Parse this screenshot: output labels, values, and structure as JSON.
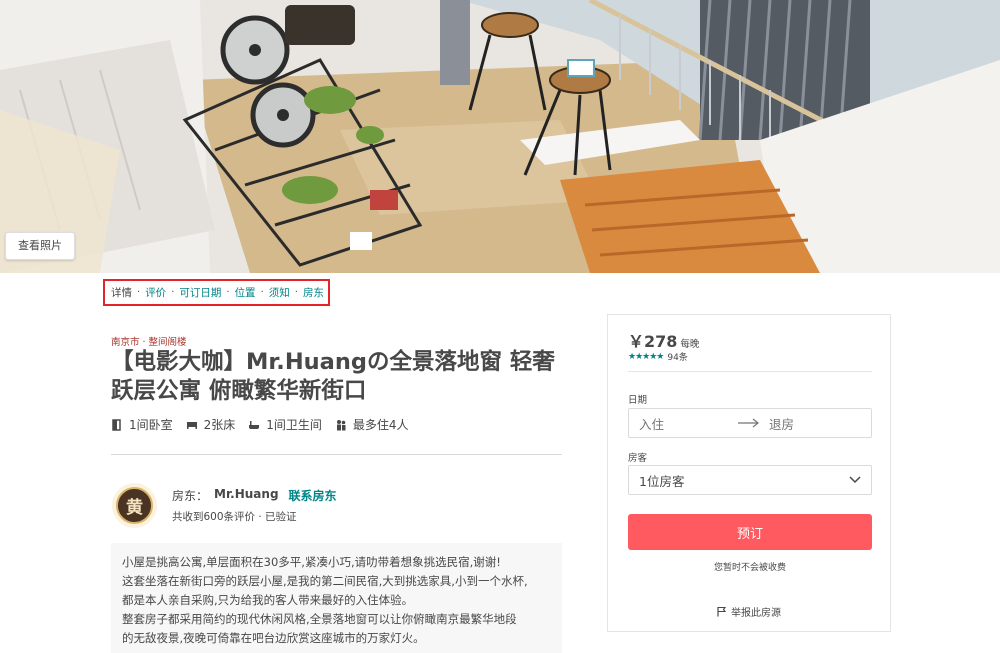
{
  "hero": {
    "view_photos_label": "查看照片"
  },
  "subnav": {
    "items": [
      {
        "label": "详情"
      },
      {
        "label": "评价"
      },
      {
        "label": "可订日期"
      },
      {
        "label": "位置"
      },
      {
        "label": "须知"
      },
      {
        "label": "房东"
      }
    ],
    "separator": "·"
  },
  "listing": {
    "breadcrumb": "南京市 · 整间阁楼",
    "title": "【电影大咖】Mr.Huangの全景落地窗 轻奢跃层公寓 俯瞰繁华新街口",
    "amenities": [
      {
        "icon": "door-icon",
        "label": "1间卧室"
      },
      {
        "icon": "bed-icon",
        "label": "2张床"
      },
      {
        "icon": "bathtub-icon",
        "label": "1间卫生间"
      },
      {
        "icon": "guests-icon",
        "label": "最多住4人"
      }
    ]
  },
  "host": {
    "avatar_char": "黄",
    "prefix": "房东：",
    "name": "Mr.Huang",
    "contact_label": "联系房东",
    "meta": "共收到600条评价 · 已验证"
  },
  "description": {
    "lines": [
      "小屋是挑高公寓,单层面积在30多平,紧凑小巧,请叻带着想象挑选民宿,谢谢!",
      "这套坐落在新街口旁的跃层小屋,是我的第二间民宿,大到挑选家具,小到一个水杯,",
      "都是本人亲自采购,只为给我的客人带来最好的入住体验。",
      "整套房子都采用简约的现代休闲风格,全景落地窗可以让你俯瞰南京最繁华地段",
      "的无敌夜景,夜晚可倚靠在吧台边欣赏这座城市的万家灯火。"
    ]
  },
  "booking": {
    "price": "￥278",
    "per_night": "每晚",
    "rating": 4.5,
    "review_count": "94条",
    "dates_label": "日期",
    "checkin_placeholder": "入住",
    "checkout_placeholder": "退房",
    "guests_label": "房客",
    "guests_value": "1位房客",
    "book_button": "预订",
    "no_charge_note": "您暂时不会被收费"
  },
  "report": {
    "label": "举报此房源"
  },
  "colors": {
    "accent_teal": "#008489",
    "brand_red": "#ff5a5f",
    "highlight_red": "#e3252a",
    "text": "#484848"
  }
}
